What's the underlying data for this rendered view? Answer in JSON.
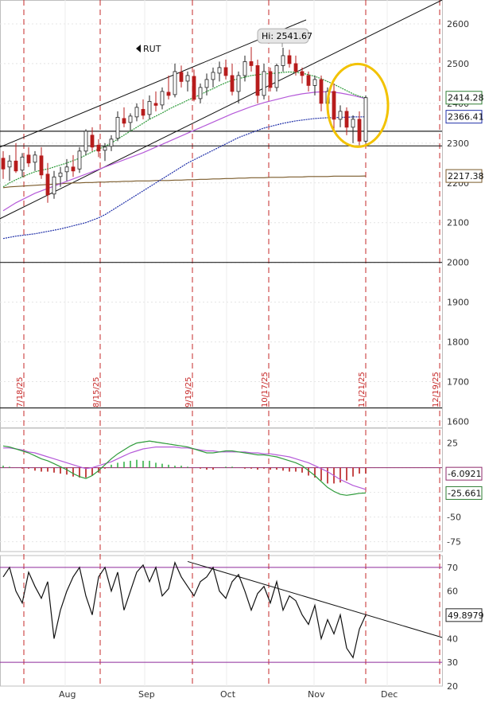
{
  "chart_data": [
    {
      "type": "candlestick",
      "symbol": "RUT",
      "yticks": [
        2600,
        2500,
        2400,
        2300,
        2200,
        2100,
        2000,
        1900,
        1800,
        1700,
        1600
      ],
      "ylim": [
        1585,
        2660
      ],
      "x_months": [
        "Aug",
        "Sep",
        "Oct",
        "Nov",
        "Dec"
      ],
      "vertical_marker_labels": [
        "7/18/25",
        "8/15/25",
        "9/19/25",
        "10/17/25",
        "11/21/25",
        "12/19/25"
      ],
      "high_label": "Hi: 2541.67",
      "high_value": 2541.67,
      "price_tags": [
        {
          "text": "2414.28",
          "value": 2414.28,
          "color": "#2e7d32"
        },
        {
          "text": "2366.41",
          "value": 2366.41,
          "color": "#1f2fa8"
        },
        {
          "text": "2217.38",
          "value": 2217.38,
          "color": "#7a5a2a"
        }
      ],
      "horizontal_levels": [
        2330,
        2293,
        2000,
        1634
      ],
      "candles": [
        {
          "o": 2262,
          "h": 2280,
          "l": 2210,
          "c": 2235
        },
        {
          "o": 2240,
          "h": 2270,
          "l": 2205,
          "c": 2255
        },
        {
          "o": 2255,
          "h": 2300,
          "l": 2225,
          "c": 2230
        },
        {
          "o": 2232,
          "h": 2275,
          "l": 2215,
          "c": 2265
        },
        {
          "o": 2270,
          "h": 2290,
          "l": 2240,
          "c": 2250
        },
        {
          "o": 2252,
          "h": 2280,
          "l": 2230,
          "c": 2270
        },
        {
          "o": 2268,
          "h": 2290,
          "l": 2210,
          "c": 2220
        },
        {
          "o": 2222,
          "h": 2250,
          "l": 2150,
          "c": 2170
        },
        {
          "o": 2172,
          "h": 2230,
          "l": 2160,
          "c": 2215
        },
        {
          "o": 2216,
          "h": 2240,
          "l": 2190,
          "c": 2225
        },
        {
          "o": 2228,
          "h": 2260,
          "l": 2205,
          "c": 2240
        },
        {
          "o": 2240,
          "h": 2270,
          "l": 2215,
          "c": 2230
        },
        {
          "o": 2235,
          "h": 2290,
          "l": 2225,
          "c": 2280
        },
        {
          "o": 2280,
          "h": 2335,
          "l": 2270,
          "c": 2330
        },
        {
          "o": 2320,
          "h": 2340,
          "l": 2280,
          "c": 2290
        },
        {
          "o": 2295,
          "h": 2310,
          "l": 2265,
          "c": 2280
        },
        {
          "o": 2282,
          "h": 2300,
          "l": 2255,
          "c": 2290
        },
        {
          "o": 2292,
          "h": 2320,
          "l": 2280,
          "c": 2310
        },
        {
          "o": 2312,
          "h": 2380,
          "l": 2305,
          "c": 2365
        },
        {
          "o": 2362,
          "h": 2390,
          "l": 2340,
          "c": 2350
        },
        {
          "o": 2352,
          "h": 2375,
          "l": 2330,
          "c": 2368
        },
        {
          "o": 2366,
          "h": 2400,
          "l": 2355,
          "c": 2390
        },
        {
          "o": 2385,
          "h": 2410,
          "l": 2360,
          "c": 2370
        },
        {
          "o": 2372,
          "h": 2420,
          "l": 2360,
          "c": 2405
        },
        {
          "o": 2400,
          "h": 2430,
          "l": 2380,
          "c": 2395
        },
        {
          "o": 2396,
          "h": 2440,
          "l": 2385,
          "c": 2430
        },
        {
          "o": 2428,
          "h": 2470,
          "l": 2410,
          "c": 2420
        },
        {
          "o": 2422,
          "h": 2500,
          "l": 2415,
          "c": 2480
        },
        {
          "o": 2478,
          "h": 2495,
          "l": 2440,
          "c": 2455
        },
        {
          "o": 2456,
          "h": 2480,
          "l": 2430,
          "c": 2470
        },
        {
          "o": 2468,
          "h": 2485,
          "l": 2405,
          "c": 2410
        },
        {
          "o": 2412,
          "h": 2450,
          "l": 2400,
          "c": 2440
        },
        {
          "o": 2440,
          "h": 2475,
          "l": 2420,
          "c": 2460
        },
        {
          "o": 2460,
          "h": 2490,
          "l": 2440,
          "c": 2478
        },
        {
          "o": 2476,
          "h": 2505,
          "l": 2455,
          "c": 2490
        },
        {
          "o": 2490,
          "h": 2510,
          "l": 2460,
          "c": 2470
        },
        {
          "o": 2470,
          "h": 2500,
          "l": 2420,
          "c": 2430
        },
        {
          "o": 2430,
          "h": 2480,
          "l": 2400,
          "c": 2470
        },
        {
          "o": 2470,
          "h": 2520,
          "l": 2455,
          "c": 2505
        },
        {
          "o": 2505,
          "h": 2541.67,
          "l": 2480,
          "c": 2495
        },
        {
          "o": 2495,
          "h": 2510,
          "l": 2400,
          "c": 2420
        },
        {
          "o": 2420,
          "h": 2500,
          "l": 2410,
          "c": 2480
        },
        {
          "o": 2480,
          "h": 2490,
          "l": 2430,
          "c": 2440
        },
        {
          "o": 2440,
          "h": 2500,
          "l": 2430,
          "c": 2495
        },
        {
          "o": 2495,
          "h": 2540,
          "l": 2480,
          "c": 2520
        },
        {
          "o": 2520,
          "h": 2535,
          "l": 2490,
          "c": 2500
        },
        {
          "o": 2500,
          "h": 2520,
          "l": 2470,
          "c": 2480
        },
        {
          "o": 2480,
          "h": 2490,
          "l": 2450,
          "c": 2470
        },
        {
          "o": 2470,
          "h": 2480,
          "l": 2430,
          "c": 2445
        },
        {
          "o": 2445,
          "h": 2470,
          "l": 2420,
          "c": 2460
        },
        {
          "o": 2460,
          "h": 2470,
          "l": 2380,
          "c": 2400
        },
        {
          "o": 2400,
          "h": 2440,
          "l": 2390,
          "c": 2430
        },
        {
          "o": 2430,
          "h": 2450,
          "l": 2330,
          "c": 2360
        },
        {
          "o": 2360,
          "h": 2395,
          "l": 2340,
          "c": 2380
        },
        {
          "o": 2380,
          "h": 2390,
          "l": 2320,
          "c": 2340
        },
        {
          "o": 2340,
          "h": 2370,
          "l": 2300,
          "c": 2360
        },
        {
          "o": 2360,
          "h": 2380,
          "l": 2295,
          "c": 2305
        },
        {
          "o": 2305,
          "h": 2420,
          "l": 2300,
          "c": 2414.28
        }
      ],
      "ma_green": [
        2190,
        2200,
        2208,
        2215,
        2222,
        2228,
        2232,
        2235,
        2240,
        2245,
        2250,
        2256,
        2262,
        2270,
        2278,
        2285,
        2292,
        2300,
        2310,
        2320,
        2330,
        2340,
        2350,
        2360,
        2368,
        2376,
        2385,
        2393,
        2400,
        2408,
        2415,
        2422,
        2430,
        2437,
        2445,
        2452,
        2458,
        2462,
        2466,
        2470,
        2472,
        2474,
        2475,
        2476,
        2478,
        2479,
        2478,
        2476,
        2472,
        2468,
        2462,
        2455,
        2448,
        2440,
        2432,
        2424,
        2418,
        2414
      ],
      "ma_violet": [
        2130,
        2140,
        2150,
        2158,
        2166,
        2174,
        2180,
        2186,
        2192,
        2198,
        2204,
        2210,
        2216,
        2222,
        2228,
        2234,
        2240,
        2246,
        2252,
        2258,
        2264,
        2270,
        2276,
        2283,
        2290,
        2297,
        2304,
        2311,
        2318,
        2325,
        2332,
        2339,
        2346,
        2353,
        2360,
        2367,
        2374,
        2380,
        2386,
        2392,
        2397,
        2402,
        2406,
        2410,
        2414,
        2418,
        2421,
        2424,
        2426,
        2428,
        2429,
        2429,
        2428,
        2426,
        2423,
        2420,
        2416,
        2412
      ],
      "ma_blue": [
        2060,
        2063,
        2066,
        2068,
        2070,
        2072,
        2075,
        2078,
        2081,
        2084,
        2088,
        2092,
        2096,
        2100,
        2106,
        2112,
        2120,
        2130,
        2140,
        2150,
        2160,
        2170,
        2180,
        2190,
        2200,
        2210,
        2220,
        2230,
        2240,
        2250,
        2258,
        2266,
        2274,
        2282,
        2290,
        2298,
        2306,
        2314,
        2320,
        2326,
        2332,
        2338,
        2342,
        2346,
        2350,
        2353,
        2356,
        2358,
        2360,
        2362,
        2363,
        2364,
        2364,
        2365,
        2365,
        2366,
        2366,
        2366.41
      ],
      "ma_brown": [
        2188,
        2190,
        2191,
        2192,
        2193,
        2194,
        2195,
        2196,
        2197,
        2198,
        2199,
        2200,
        2200,
        2201,
        2201,
        2202,
        2202,
        2203,
        2203,
        2204,
        2204,
        2205,
        2205,
        2205,
        2206,
        2206,
        2206,
        2207,
        2207,
        2208,
        2208,
        2209,
        2209,
        2210,
        2210,
        2211,
        2211,
        2212,
        2212,
        2213,
        2213,
        2213,
        2214,
        2214,
        2214,
        2215,
        2215,
        2215,
        2216,
        2216,
        2216,
        2216,
        2217,
        2217,
        2217,
        2217,
        2217,
        2217.38
      ]
    },
    {
      "type": "line",
      "panel": "macd",
      "yticks": [
        25,
        0,
        -25,
        -50,
        -75
      ],
      "ylim": [
        -85,
        40
      ],
      "price_tags": [
        {
          "text": "-6.0921",
          "value": -6.0921,
          "color": "#8e2a6b"
        },
        {
          "text": "-25.661",
          "value": -25.661,
          "color": "#2e7d32"
        }
      ],
      "series": [
        {
          "values": [
            22,
            21,
            19,
            17,
            15,
            12,
            9,
            7,
            4,
            1,
            -2,
            -6,
            -9,
            -11,
            -8,
            -3,
            3,
            9,
            14,
            18,
            22,
            25,
            26,
            27,
            26,
            25,
            24,
            23,
            22,
            21,
            19,
            17,
            15,
            15,
            16,
            17,
            17,
            16,
            15,
            14,
            13,
            13,
            12,
            11,
            9,
            7,
            5,
            2,
            -3,
            -8,
            -14,
            -20,
            -24,
            -27,
            -28,
            -27,
            -26,
            -25.661
          ]
        },
        {
          "values": [
            20,
            20,
            19,
            18,
            16,
            15,
            13,
            11,
            9,
            7,
            5,
            3,
            1,
            -1,
            0,
            2,
            4,
            6,
            9,
            12,
            15,
            17,
            19,
            20,
            21,
            21,
            21,
            21,
            20,
            20,
            19,
            18,
            17,
            17,
            16,
            16,
            16,
            16,
            16,
            15,
            15,
            14,
            14,
            13,
            12,
            11,
            9,
            7,
            5,
            2,
            -1,
            -4,
            -8,
            -12,
            -15,
            -18,
            -20,
            -22
          ]
        }
      ],
      "histogram": [
        2,
        1,
        0,
        -1,
        -1,
        -3,
        -4,
        -4,
        -5,
        -6,
        -7,
        -9,
        -10,
        -10,
        -8,
        -5,
        -1,
        3,
        5,
        6,
        7,
        8,
        7,
        7,
        5,
        4,
        3,
        2,
        2,
        1,
        0,
        -1,
        -2,
        -2,
        0,
        1,
        1,
        0,
        -1,
        -1,
        -2,
        -1,
        -2,
        -2,
        -3,
        -4,
        -4,
        -5,
        -8,
        -10,
        -13,
        -16,
        -16,
        -15,
        -13,
        -9,
        -6,
        -6.0921
      ]
    },
    {
      "type": "line",
      "panel": "rsi",
      "yticks": [
        70,
        60,
        50,
        40,
        30,
        20
      ],
      "ylim": [
        20,
        75
      ],
      "levels": [
        70,
        30
      ],
      "price_tags": [
        {
          "text": "49.8979",
          "value": 49.8979,
          "color": "#222222"
        }
      ],
      "values": [
        66,
        70,
        60,
        55,
        68,
        62,
        57,
        64,
        40,
        52,
        60,
        66,
        70,
        58,
        50,
        66,
        70,
        60,
        68,
        52,
        60,
        68,
        71,
        64,
        70,
        58,
        61,
        72,
        66,
        62,
        58,
        64,
        66,
        70,
        60,
        57,
        64,
        67,
        60,
        52,
        59,
        62,
        55,
        64,
        52,
        58,
        56,
        50,
        46,
        54,
        40,
        48,
        42,
        50,
        36,
        32,
        44,
        49.8979
      ],
      "trendline_label": ""
    }
  ]
}
